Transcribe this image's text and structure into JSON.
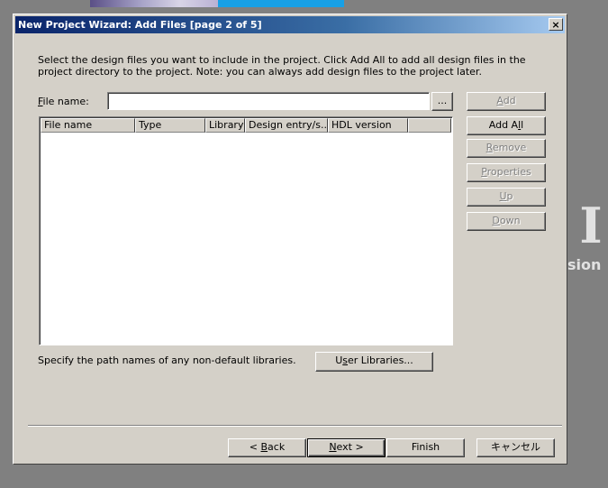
{
  "window": {
    "title": "New Project Wizard: Add Files [page 2 of 5]",
    "close_symbol": "×"
  },
  "description": "Select the design files you want to include in the project. Click Add All to add all design files in the project directory to the project. Note: you can always add design files to the project later.",
  "file_name": {
    "label": "File name:",
    "value": "",
    "browse_label": "..."
  },
  "side_buttons": {
    "add": "Add",
    "add_all": "Add All",
    "remove": "Remove",
    "properties": "Properties",
    "up": "Up",
    "down": "Down"
  },
  "file_table": {
    "columns": [
      "File name",
      "Type",
      "Library",
      "Design entry/s...",
      "HDL version"
    ],
    "rows": []
  },
  "libraries": {
    "text": "Specify the path names of any non-default libraries.",
    "button": "User Libraries..."
  },
  "footer": {
    "back": "< Back",
    "next": "Next >",
    "finish": "Finish",
    "cancel": "キャンセル"
  },
  "background": {
    "big_letter": "I",
    "partial_word": "sion"
  },
  "colors": {
    "title_bar_start": "#0a246a",
    "title_bar_end": "#a6caf0",
    "dialog_face": "#d4d0c8",
    "desktop": "#808080",
    "disabled_text": "#808080"
  }
}
